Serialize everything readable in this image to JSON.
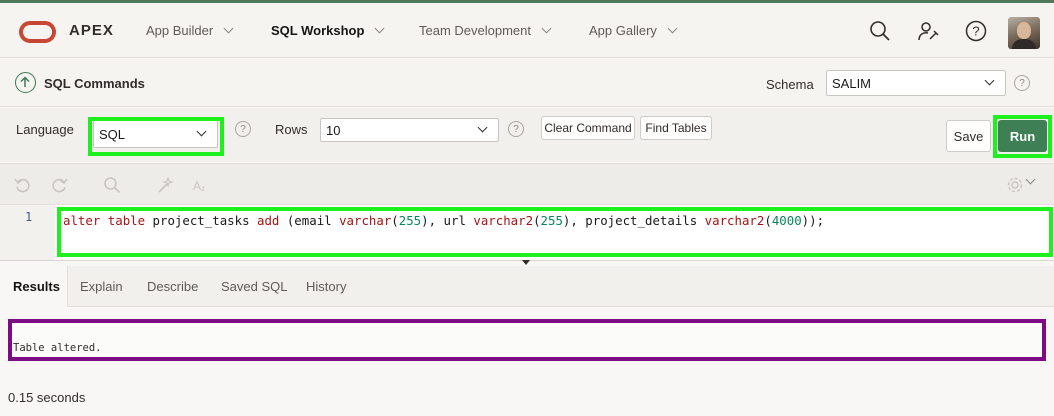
{
  "app": {
    "logo_text": "APEX"
  },
  "nav": {
    "items": [
      {
        "label": "App Builder"
      },
      {
        "label": "SQL Workshop"
      },
      {
        "label": "Team Development"
      },
      {
        "label": "App Gallery"
      }
    ],
    "icons": [
      "search-icon",
      "user-wrench-icon",
      "help-icon",
      "avatar"
    ]
  },
  "page": {
    "title": "SQL Commands",
    "schema_label": "Schema",
    "schema_value": "SALIM"
  },
  "toolbar": {
    "language_label": "Language",
    "language_value": "SQL",
    "rows_label": "Rows",
    "rows_value": "10",
    "clear_command_label": "Clear Command",
    "find_tables_label": "Find Tables",
    "save_label": "Save",
    "run_label": "Run"
  },
  "editor": {
    "line_number": "1",
    "code": {
      "t1": "alter",
      "t2": " ",
      "t3": "table",
      "t4": " project_tasks ",
      "t5": "add",
      "t6": " (email ",
      "t7": "varchar",
      "t8": "(",
      "t9": "255",
      "t10": "), url ",
      "t11": "varchar2",
      "t12": "(",
      "t13": "255",
      "t14": "), project_details ",
      "t15": "varchar2",
      "t16": "(",
      "t17": "4000",
      "t18": "));"
    }
  },
  "tabs": [
    {
      "label": "Results"
    },
    {
      "label": "Explain"
    },
    {
      "label": "Describe"
    },
    {
      "label": "Saved SQL"
    },
    {
      "label": "History"
    }
  ],
  "results": {
    "message": "Table altered.",
    "timing": "0.15 seconds"
  },
  "colors": {
    "brand_red": "#c74634",
    "run_green": "#3f7f55",
    "highlight_green": "#1ef01e",
    "highlight_purple": "#7d0b85"
  }
}
